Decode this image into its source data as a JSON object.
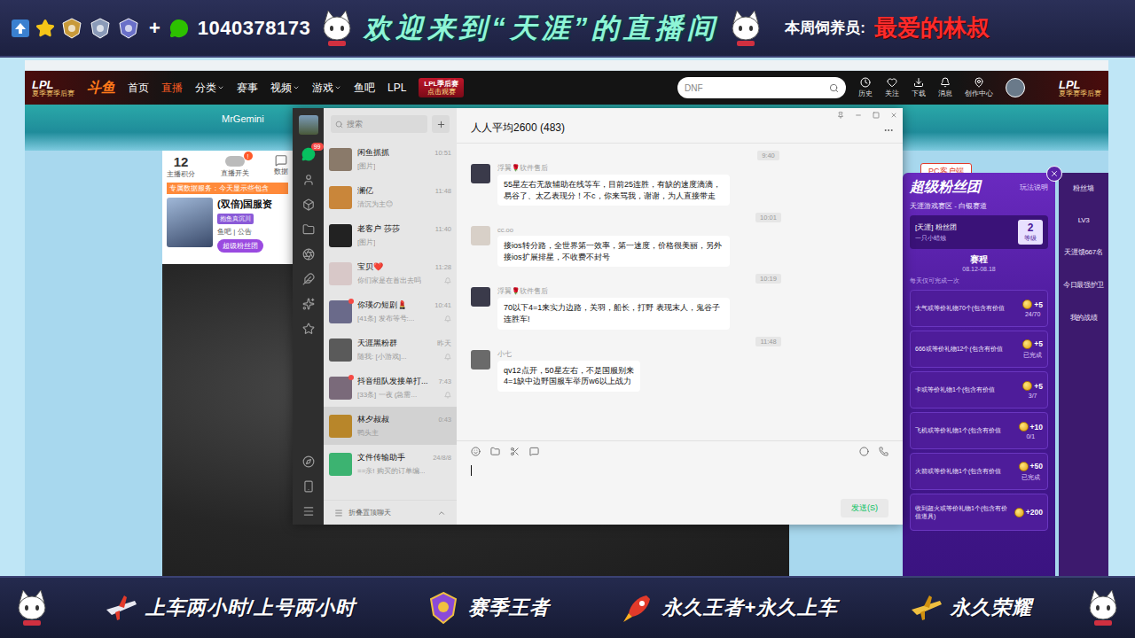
{
  "banner": {
    "plus": "+",
    "wechat_id": "1040378173",
    "welcome": "欢迎来到“天涯”的直播间",
    "feeder_label": "本周饲养员:",
    "feeder": "最爱的林叔"
  },
  "browser": {
    "logo": "LPL",
    "logo_sub": "夏季赛季后赛",
    "site": "斗鱼",
    "nav": [
      {
        "label": "首页",
        "selected": false,
        "dropdown": false
      },
      {
        "label": "直播",
        "selected": true,
        "dropdown": false
      },
      {
        "label": "分类",
        "selected": false,
        "dropdown": true
      },
      {
        "label": "赛事",
        "selected": false,
        "dropdown": false
      },
      {
        "label": "视频",
        "selected": false,
        "dropdown": true
      },
      {
        "label": "游戏",
        "selected": false,
        "dropdown": true
      },
      {
        "label": "鱼吧",
        "selected": false,
        "dropdown": false
      },
      {
        "label": "LPL",
        "selected": false,
        "dropdown": false
      }
    ],
    "promo": {
      "title": "LPL季后赛",
      "sub": "点击观赛"
    },
    "search": {
      "value": "DNF"
    },
    "actions": [
      "历史",
      "关注",
      "下载",
      "消息",
      "创作中心"
    ],
    "right_logo": "LPL",
    "right_logo_sub": "夏季赛季后赛"
  },
  "page": {
    "streamer": "MrGemini",
    "points": "12",
    "points_label": "主播积分",
    "switch_label": "直播开关",
    "switch_badge": "!",
    "data_label": "数据",
    "notice": "专属数据服务：今天显示些包含",
    "room_title": "(双倍)国服资",
    "tag": "抱鱼真沉川",
    "links": "鱼吧 | 公告",
    "fan_button": "超级粉丝团",
    "pc_client": "PC客户端"
  },
  "wechat": {
    "badge": "99",
    "search_placeholder": "搜索",
    "title": "人人平均2600 (483)",
    "footer": "折叠置顶聊天",
    "send": "发送(S)",
    "chats": [
      {
        "name": "闲鱼抓抓",
        "preview": "[图片]",
        "time": "10:51",
        "color": "#8a7a6a",
        "selected": false,
        "muted": false,
        "unread": false
      },
      {
        "name": "澜亿",
        "preview": "清沉为主😊",
        "time": "11:48",
        "color": "#c9863a",
        "selected": false,
        "muted": false,
        "unread": false
      },
      {
        "name": "老客户 莎莎",
        "preview": "[图片]",
        "time": "11:40",
        "color": "#222222",
        "selected": false,
        "muted": false,
        "unread": false
      },
      {
        "name": "宝贝❤️",
        "preview": "你们家是在首出去吗",
        "time": "11:28",
        "color": "#d8c8c8",
        "selected": false,
        "muted": true,
        "unread": false
      },
      {
        "name": "你瑛の短剧💄",
        "preview": "[41条] 发布等号:...",
        "time": "10:41",
        "color": "#6a6a8a",
        "selected": false,
        "muted": true,
        "unread": true
      },
      {
        "name": "天涯黑粉群",
        "preview": "随我: [小游戏]...",
        "time": "昨天",
        "color": "#5a5a5a",
        "selected": false,
        "muted": true,
        "unread": false
      },
      {
        "name": "抖音组队发接单打...",
        "preview": "[33条] 一夜 (急需...",
        "time": "7:43",
        "color": "#7a6a7a",
        "selected": false,
        "muted": true,
        "unread": true
      },
      {
        "name": "林夕叔叔",
        "preview": "鸭头主",
        "time": "0:43",
        "color": "#b8862a",
        "selected": true,
        "muted": false,
        "unread": false
      },
      {
        "name": "文件传输助手",
        "preview": "==亲! 购买的订单编...",
        "time": "24/8/8",
        "color": "#3cb371",
        "selected": false,
        "muted": false,
        "unread": false
      }
    ],
    "messages": [
      {
        "time": "9:40",
        "sender": "浮翼🌹软件售后",
        "color": "#3a3a4a",
        "text": "55星左右无敌辅助在线等车，目前25连胜，有缺的速度滴滴，易谷了、太乙表现分！不c，你来骂我，谢谢，为人直接带走"
      },
      {
        "time": "10:01",
        "sender": "cc.oo",
        "color": "#d8d0c8",
        "text": "接ios转分路，全世界第一效率，第一速度，价格很美丽，另外接ios扩展排星，不收费不封号"
      },
      {
        "time": "10:19",
        "sender": "浮翼🌹软件售后",
        "color": "#3a3a4a",
        "text": "70以下4=1来实力边路，关羽，船长，打野 表现末人，鬼谷子连胜车!"
      },
      {
        "time": "11:48",
        "sender": "小七",
        "color": "#6a6a6a",
        "text": "qv12点开，50星左右，不是国服别来\n4=1缺中边野国服车举历w6以上战力"
      }
    ]
  },
  "fan_panel": {
    "title": "超级粉丝团",
    "help": "玩法说明",
    "division": "天涯游戏赛区 - 白银赛道",
    "group": "[天涯] 粉丝团",
    "group_sub": "一只小蜡烛",
    "level": "2",
    "level_label": "等级",
    "tab": "赛程",
    "period": "08.12-08.18",
    "note": "每天仅可完成一次",
    "tasks": [
      {
        "label": "大气或等价礼物70个(包含有价值",
        "reward": "+5",
        "progress": "24/70"
      },
      {
        "label": "666或等价礼物12个(包含有价值",
        "reward": "+5",
        "progress": "已完成"
      },
      {
        "label": "卡或等价礼物1个(包含有价值",
        "reward": "+5",
        "progress": "3/7"
      },
      {
        "label": "飞机或等价礼物1个(包含有价值",
        "reward": "+10",
        "progress": "0/1"
      },
      {
        "label": "火箭或等价礼物1个(包含有价值",
        "reward": "+50",
        "progress": "已完成"
      },
      {
        "label": "收到超火或等价礼物1个(包含有价值道具)",
        "reward": "+200",
        "progress": ""
      }
    ]
  },
  "side_strip": [
    "粉丝墙",
    "LV3",
    "天涯馈667名",
    "今日最强护卫",
    "我的战绩"
  ],
  "bottom_banner": [
    {
      "label": "上车两小时/上号两小时",
      "kind": "plane"
    },
    {
      "label": "赛季王者",
      "kind": "medal"
    },
    {
      "label": "永久王者+永久上车",
      "kind": "rocket"
    },
    {
      "label": "永久荣耀",
      "kind": "jet"
    }
  ]
}
